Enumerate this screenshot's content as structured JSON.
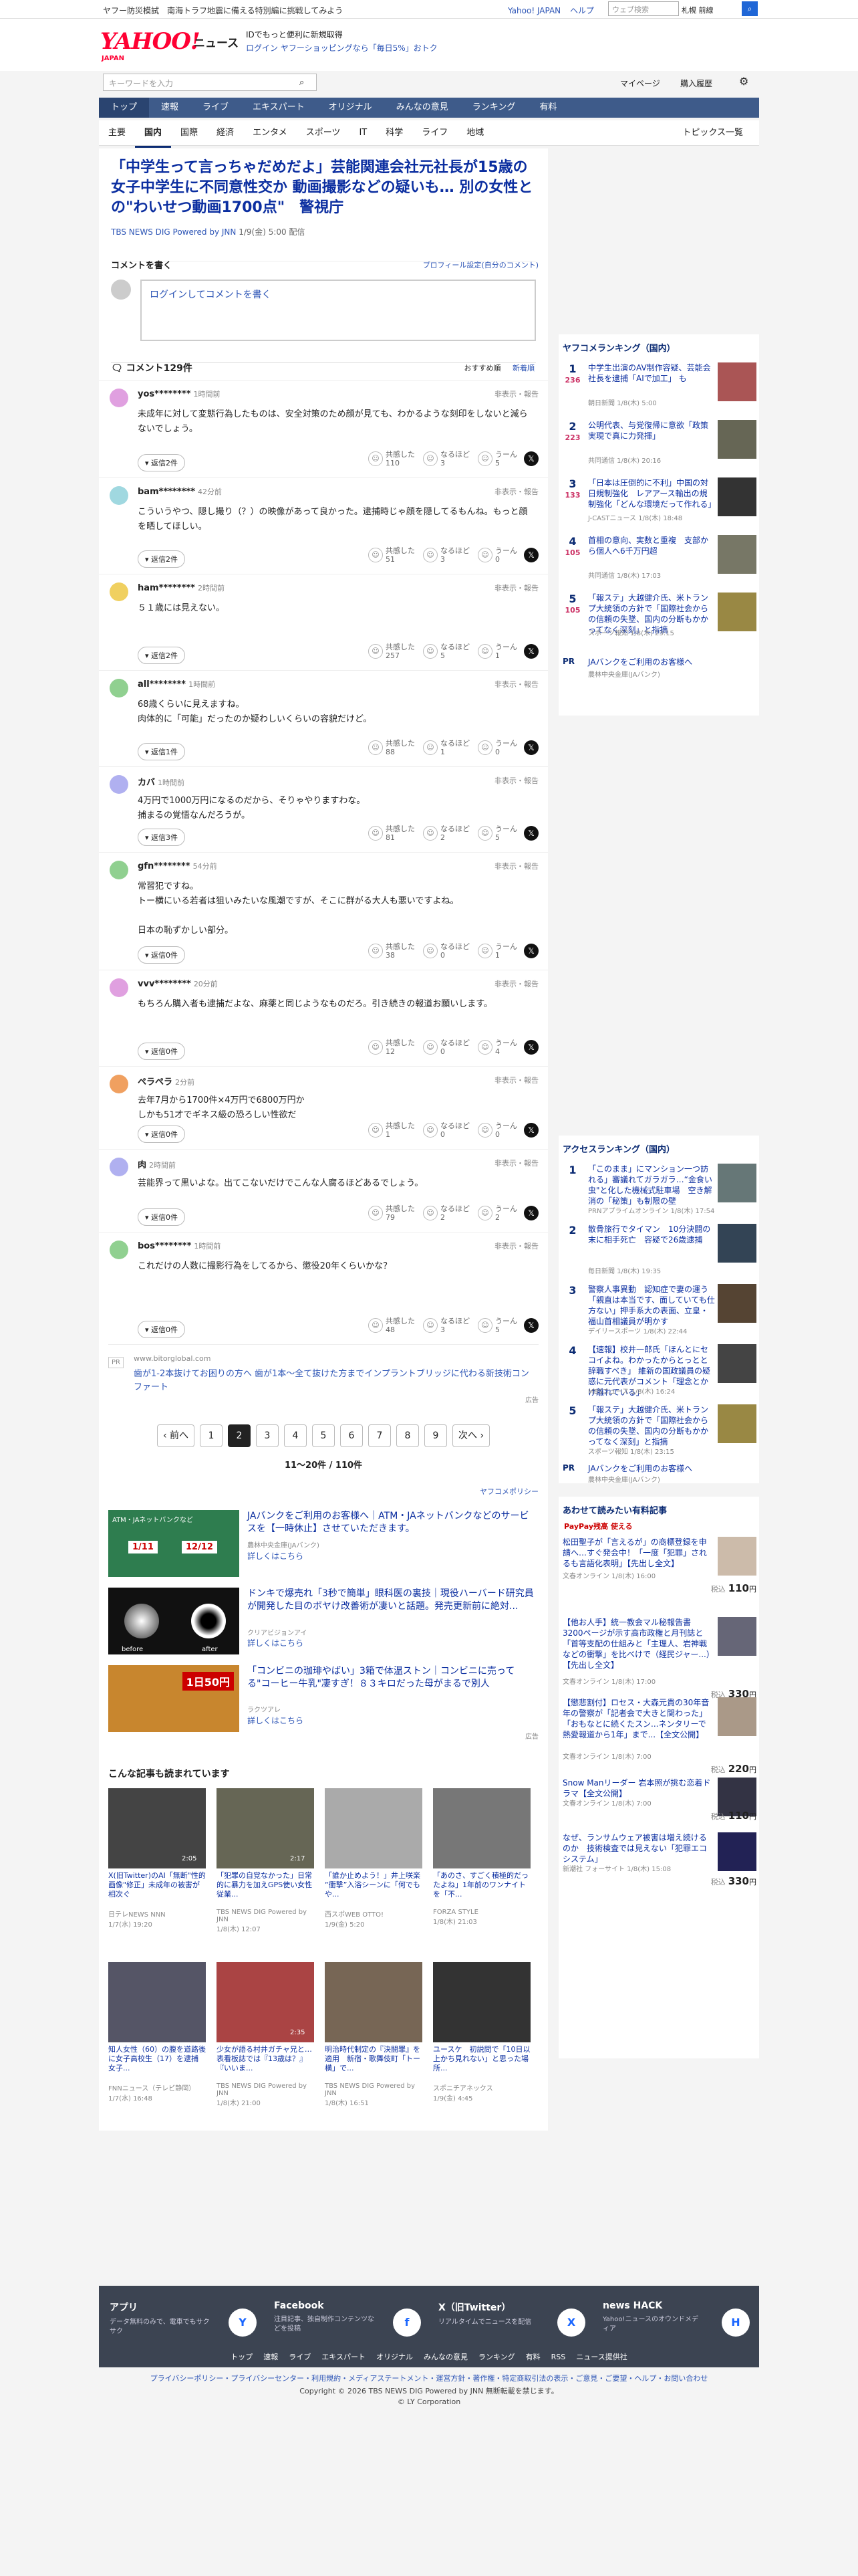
{
  "top": {
    "promo_left": "ヤフー防災模試　南海トラフ地震に備える特別編に挑戦してみよう",
    "links": [
      "Yahoo! JAPAN",
      "ヘルプ"
    ],
    "search_placeholder": "ウェブ検索",
    "weather": "札幌 前線"
  },
  "header": {
    "logo": "YAHOO!",
    "logo_sub": "JAPAN",
    "news": "ニュース",
    "promo1": "IDでもっと便利に新規取得",
    "promo2": "ログイン  ヤフーショッピングなら「毎日5%」おトク",
    "search_placeholder": "キーワードを入力",
    "mypage": "マイページ",
    "history": "購入履歴"
  },
  "nav1": [
    "トップ",
    "速報",
    "ライブ",
    "エキスパート",
    "オリジナル",
    "みんなの意見",
    "ランキング",
    "有料"
  ],
  "nav2": [
    "主要",
    "国内",
    "国際",
    "経済",
    "エンタメ",
    "スポーツ",
    "IT",
    "科学",
    "ライフ",
    "地域"
  ],
  "topics": "トピックス一覧",
  "article": {
    "title": "「中学生って言っちゃだめだよ」芸能関連会社元社長が15歳の女子中学生に不同意性交か 動画撮影などの疑いも… 別の女性との\"わいせつ動画1700点\"　警視庁",
    "source": "TBS NEWS DIG Powered by JNN",
    "date": "1/9(金) 5:00 配信"
  },
  "comment_form": {
    "label": "コメントを書く",
    "profile": "プロフィール設定(自分のコメント)",
    "placeholder": "ログインしてコメントを書く"
  },
  "comments_head": {
    "count": "コメント129件",
    "sort1": "おすすめ順",
    "sort2": "新着順"
  },
  "labels": {
    "reply": "返信",
    "report": "非表示・報告",
    "kyokan": "共感した",
    "naruhodo": "なるほど",
    "un": "うーん"
  },
  "comments": [
    {
      "name": "yos********",
      "time": "1時間前",
      "text": "未成年に対して変態行為したものは、安全対策のため顔が見ても、わかるような刻印をしないと減らないでしょう。",
      "replies": "返信2件",
      "k": "110",
      "n": "3",
      "u": "5",
      "color": "#e0a0e0"
    },
    {
      "name": "bam********",
      "time": "42分前",
      "text": "こういうやつ、隠し撮り（？）の映像があって良かった。逮捕時じゃ顔を隠してるもんね。もっと顔を晒してほしい。",
      "replies": "返信2件",
      "k": "51",
      "n": "3",
      "u": "0",
      "color": "#a0d8e0"
    },
    {
      "name": "ham********",
      "time": "2時間前",
      "text": "５１歳には見えない。",
      "replies": "返信2件",
      "k": "257",
      "n": "5",
      "u": "1",
      "color": "#f0d060"
    },
    {
      "name": "all********",
      "time": "1時間前",
      "text": "68歳くらいに見えますね。\n肉体的に「可能」だったのか疑わしいくらいの容貌だけど。",
      "replies": "返信1件",
      "k": "88",
      "n": "1",
      "u": "0",
      "color": "#90d090"
    },
    {
      "name": "カバ",
      "time": "1時間前",
      "text": "4万円で1000万円になるのだから、そりゃやりますわな。\n捕まるの覚悟なんだろうが。",
      "replies": "返信3件",
      "k": "81",
      "n": "2",
      "u": "5",
      "color": "#b0b0f0"
    },
    {
      "name": "gfn********",
      "time": "54分前",
      "text": "常習犯ですね。\nトー横にいる若者は狙いみたいな風潮ですが、そこに群がる大人も悪いですよね。\n\n日本の恥ずかしい部分。",
      "replies": "返信0件",
      "k": "38",
      "n": "0",
      "u": "1",
      "color": "#90d090"
    },
    {
      "name": "vvv********",
      "time": "20分前",
      "text": "もちろん購入者も逮捕だよな、麻薬と同じようなものだろ。引き続きの報道お願いします。",
      "replies": "返信0件",
      "k": "12",
      "n": "0",
      "u": "4",
      "color": "#e0a0e0"
    },
    {
      "name": "ペラペラ",
      "time": "2分前",
      "text": "去年7月から1700件×4万円で6800万円か\nしかも51才でギネス級の恐ろしい性欲だ",
      "replies": "返信0件",
      "k": "1",
      "n": "0",
      "u": "0",
      "color": "#f0a060"
    },
    {
      "name": "肉",
      "time": "2時間前",
      "text": "芸能界って黒いよな。出てこないだけでこんな人腐るほどあるでしょう。",
      "replies": "返信0件",
      "k": "79",
      "n": "2",
      "u": "2",
      "color": "#b0b0f0"
    },
    {
      "name": "bos********",
      "time": "1時間前",
      "text": "これだけの人数に撮影行為をしてるから、懲役20年くらいかな？",
      "replies": "返信0件",
      "k": "48",
      "n": "3",
      "u": "5",
      "color": "#90d090"
    }
  ],
  "pr_inline": {
    "url": "www.bitorglobal.com",
    "text": "歯が1-2本抜けてお困りの方へ 歯が1本〜全て抜けた方までインプラントブリッジに代わる新技術コンファート",
    "tag": "PR",
    "ad": "広告"
  },
  "pager": {
    "prev": "‹ 前へ",
    "pages": [
      "1",
      "2",
      "3",
      "4",
      "5",
      "6",
      "7",
      "8",
      "9"
    ],
    "next": "次へ ›",
    "summary": "11〜20件 / 110件"
  },
  "policy": "ヤフコメポリシー",
  "ads": [
    {
      "title": "JAバンクをご利用のお客様へ｜ATM・JAネットバンクなどのサービスを【一時休止】させていただきます。",
      "sponsor": "農林中央金庫(JAバンク)",
      "link": "詳しくはこちら",
      "img": "ATM・JAネットバンクなど",
      "dates": [
        "1/11",
        "12/12"
      ]
    },
    {
      "title": "ドンキで爆売れ「3秒で簡単」眼科医の裏技｜現役ハーバード研究員が開発した目のボヤけ改善術が凄いと話題。発売更新前に絶対...",
      "sponsor": "クリアビジョンアイ",
      "link": "詳しくはこちら",
      "img": [
        "before",
        "after"
      ]
    },
    {
      "title": "「コンビニの珈琲やばい」3箱で体温ストン｜コンビニに売ってる\"コーヒー牛乳\"凄すぎ！８３キロだった母がまるで別人",
      "sponsor": "ラクツアレ",
      "link": "詳しくはこちら",
      "img": "1日50円"
    }
  ],
  "ad_label": "広告",
  "related": {
    "title": "こんな記事も読まれています",
    "items": [
      {
        "t": "X(旧Twitter)のAI「無断\"性的画像\"修正」未成年の被害が相次ぐ",
        "s": "日テレNEWS NNN",
        "d": "1/7(水) 19:20",
        "dur": "2:05"
      },
      {
        "t": "「犯罪の自覚なかった」日常的に暴力を加えGPS使い女性従業...",
        "s": "TBS NEWS DIG Powered by JNN",
        "d": "1/8(木) 12:07",
        "dur": "2:17"
      },
      {
        "t": "「誰か止めよう！」井上咲楽 “衝撃”入浴シーンに「何でもや...",
        "s": "西スポWEB OTTO!",
        "d": "1/9(金) 5:20",
        "dur": ""
      },
      {
        "t": "「あのさ、すごく積極的だったよね」1年前のワンナイトを「不...",
        "s": "FORZA STYLE",
        "d": "1/8(木) 21:03",
        "dur": ""
      },
      {
        "t": "知人女性（60）の腹を道路後に女子高校生（17）を逮捕　女子...",
        "s": "FNNニュース（テレビ静岡）",
        "d": "1/7(水) 16:48",
        "dur": ""
      },
      {
        "t": "少女が語る村井ガチャ兄と…表看板誌では『13歳は？』『いいま...",
        "s": "TBS NEWS DIG Powered by JNN",
        "d": "1/8(木) 21:00",
        "dur": "2:35"
      },
      {
        "t": "明治時代制定の『決闘罪』を適用　新宿・歌舞伎町「トー横」で...",
        "s": "TBS NEWS DIG Powered by JNN",
        "d": "1/8(木) 16:51",
        "dur": ""
      },
      {
        "t": "ユースケ　初説問で「10日以上かち見れない」と思った場所...",
        "s": "スポニチアネックス",
        "d": "1/9(金) 4:45",
        "dur": ""
      }
    ]
  },
  "ranking1": {
    "title": "ヤフコメランキング（国内）",
    "items": [
      {
        "n": "1",
        "pv": "236",
        "t": "中学生出演のAV制作容疑、芸能会社長を逮捕「AIで加工」 も",
        "s": "朝日新聞 1/8(木) 5:00"
      },
      {
        "n": "2",
        "pv": "223",
        "t": "公明代表、与党復帰に意欲「政策実現で真に力発揮」",
        "s": "共同通信 1/8(木) 20:16"
      },
      {
        "n": "3",
        "pv": "133",
        "t": "「日本は圧倒的に不利」中国の対日規制強化　レアアース輸出の規制強化「どんな環境だって作れる」",
        "s": "J-CASTニュース 1/8(木) 18:48"
      },
      {
        "n": "4",
        "pv": "105",
        "t": "首相の意向、実数と重複　支部から個人へ6千万円超",
        "s": "共同通信 1/8(木) 17:03"
      },
      {
        "n": "5",
        "pv": "105",
        "t": "「報ステ」大越健介氏、米トランプ大統領の方針で「国際社会からの信頼の失墜、国内の分断もかかってなく深刻」と指摘",
        "s": "スポーツ報知 1/8(木) 23:15"
      }
    ],
    "pr": {
      "t": "JAバンクをご利用のお客様へ",
      "s": "農林中央金庫(JAバンク)"
    }
  },
  "ranking2": {
    "title": "アクセスランキング（国内）",
    "items": [
      {
        "n": "1",
        "t": "「このまま」にマンション一つ訪れる」審議れてガラガラ…“金食い虫\"と化した機械式駐車場　空き解消の「秘策」も制限の壁",
        "s": "PRNアプライムオンライン 1/8(木) 17:54"
      },
      {
        "n": "2",
        "t": "散骨旅行でタイマン　10分決闘の末に相手死亡　容疑で26歳逮捕",
        "s": "毎日新聞 1/8(木) 19:35"
      },
      {
        "n": "3",
        "t": "警察人事異動　認知症で妻の運う「親直は本当です、面していても仕方ない」押手系大の表面、立皇・福山首相議員が明かす",
        "s": "デイリースポーツ 1/8(木) 22:44"
      },
      {
        "n": "4",
        "t": "【速報】校井一郎氏「ほんとにセコイよね。わかったからとっとと辞職すべき」 維新の国政議員の疑惑に元代表がコメント「理念とかけ離れている」",
        "s": "MBSニュース 1/8(木) 16:24"
      },
      {
        "n": "5",
        "t": "「報ステ」大越健介氏、米トランプ大統領の方針で「国際社会からの信頼の失墜、国内の分断もかかってなく深刻」と指摘",
        "s": "スポーツ報知 1/8(木) 23:15"
      }
    ],
    "pr": {
      "t": "JAバンクをご利用のお客様へ",
      "s": "農林中央金庫(JAバンク)"
    }
  },
  "paid": {
    "title": "あわせて読みたい有料記事",
    "badge": "PayPay残高 使える",
    "items": [
      {
        "t": "松田聖子が「言えるが」の商標登録を申請へ…すぐ発会中！「一度「犯罪」されるも言語化表明」【先出し全文】",
        "s": "文春オンライン 1/8(木) 16:00",
        "p": "110"
      },
      {
        "t": "【他お人手】統一教会マル秘報告書3200ページが示す高市政権と月刊誌と「首等支配の仕組みと「主理人、岩神戦などの衝撃」を比べけで（経民ジャー...）【先出し全文】",
        "s": "文春オンライン 1/8(木) 17:00",
        "p": "330"
      },
      {
        "t": "【懲悲割付】ロセス・大森元貴の30年音年の警察が「記者会で大きと関わった」「おもなとに続くたスン...ネンタリーで熱愛報道から1年」まで...【全文公開】",
        "s": "文春オンライン 1/8(木) 7:00",
        "p": "220"
      },
      {
        "t": "Snow Manリーダー 岩本照が挑む恋着ドラマ【全文公開】",
        "s": "文春オンライン 1/8(木) 7:00",
        "p": "110"
      },
      {
        "t": "なぜ、ランサムウェア被害は増え続けるのか　技術検査では見えない「犯罪エコシステム」",
        "s": "新潮社 フォーサイト 1/8(木) 15:08",
        "p": "330"
      }
    ],
    "yen": "円",
    "tax": "税込"
  },
  "footer": {
    "cols": [
      {
        "h": "アプリ",
        "d": "データ無料のみで、電車でもサクサク",
        "i": "Y"
      },
      {
        "h": "Facebook",
        "d": "注目記事、独自制作コンテンツなどを投稿",
        "i": "f"
      },
      {
        "h": "X（旧Twitter）",
        "d": "リアルタイムでニュースを配信",
        "i": "X"
      },
      {
        "h": "news HACK",
        "d": "Yahoo!ニュースのオウンドメディア",
        "i": "H"
      }
    ],
    "links": [
      "トップ",
      "速報",
      "ライブ",
      "エキスパート",
      "オリジナル",
      "みんなの意見",
      "ランキング",
      "有料",
      "RSS",
      "ニュース提供社"
    ]
  },
  "bottom_links": "プライバシーポリシー・プライバシーセンター・利用規約・メディアステートメント・運営方針・著作権・特定商取引法の表示・ご意見・ご要望・ヘルプ・お問い合わせ",
  "copyright1": "Copyright © 2026 TBS NEWS DIG Powered by JNN 無断転載を禁じます。",
  "copyright2": "© LY Corporation"
}
